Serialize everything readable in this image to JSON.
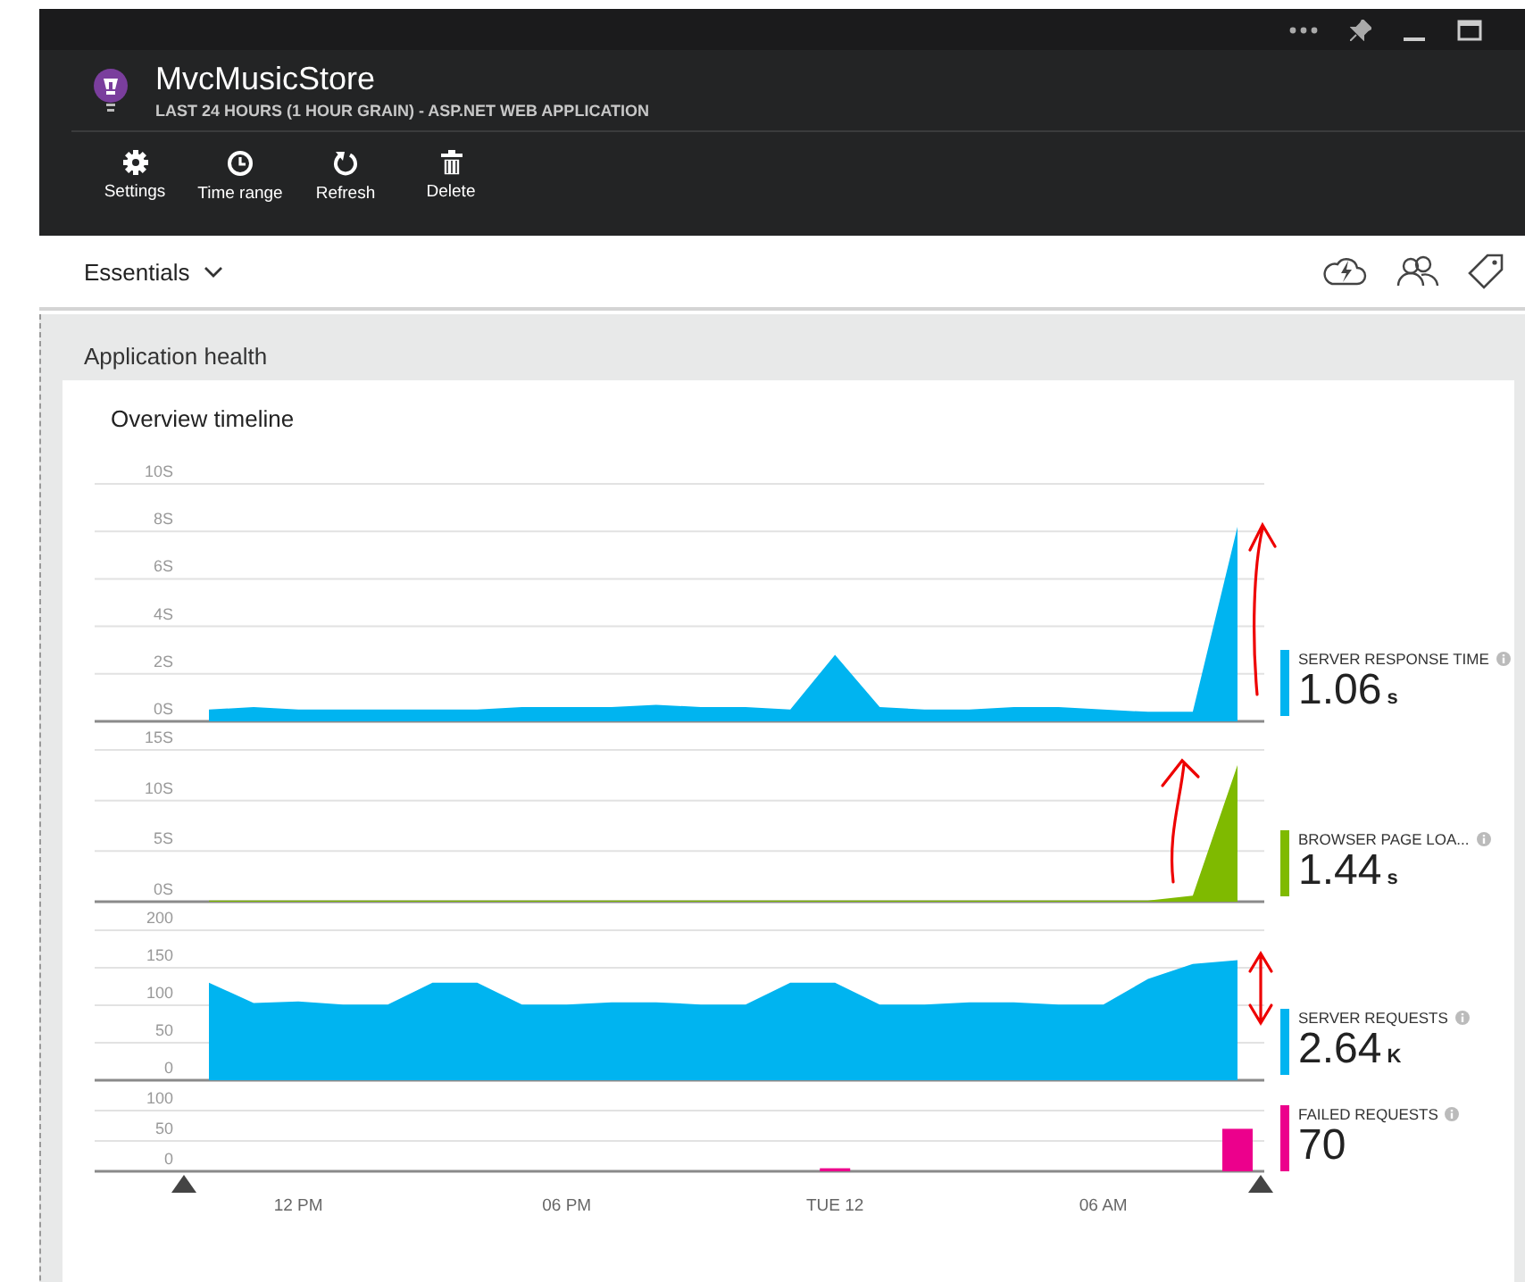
{
  "header": {
    "title": "MvcMusicStore",
    "subtitle": "LAST 24 HOURS (1 HOUR GRAIN) - ASP.NET WEB APPLICATION"
  },
  "toolbar": [
    {
      "kind": "settings",
      "label": "Settings"
    },
    {
      "kind": "time",
      "label": "Time range"
    },
    {
      "kind": "refresh",
      "label": "Refresh"
    },
    {
      "kind": "delete",
      "label": "Delete"
    }
  ],
  "essentials": {
    "label": "Essentials",
    "expanded": false
  },
  "section": {
    "title": "Application health"
  },
  "card": {
    "title": "Overview timeline"
  },
  "charts": [
    {
      "metric": {
        "label": "SERVER RESPONSE TIME",
        "value": "1.06",
        "unit": "s"
      },
      "chart_data": {
        "type": "area",
        "grid": true,
        "ylim": [
          0,
          10
        ],
        "yticks": [
          {
            "value": 0,
            "label": "0S"
          },
          {
            "value": 2,
            "label": "2S"
          },
          {
            "value": 4,
            "label": "4S"
          },
          {
            "value": 6,
            "label": "6S"
          },
          {
            "value": 8,
            "label": "8S"
          },
          {
            "value": 10,
            "label": "10S"
          }
        ],
        "series": [
          {
            "color": "#00b4f0",
            "values": [
              0.5,
              0.6,
              0.5,
              0.5,
              0.5,
              0.5,
              0.5,
              0.6,
              0.6,
              0.6,
              0.7,
              0.6,
              0.6,
              0.5,
              2.8,
              0.6,
              0.5,
              0.5,
              0.6,
              0.6,
              0.5,
              0.4,
              0.4,
              8.2
            ]
          }
        ]
      }
    },
    {
      "metric": {
        "label": "BROWSER PAGE LOA...",
        "value": "1.44",
        "unit": "s"
      },
      "chart_data": {
        "type": "area",
        "grid": true,
        "ylim": [
          0,
          15
        ],
        "yticks": [
          {
            "value": 0,
            "label": "0S"
          },
          {
            "value": 5,
            "label": "5S"
          },
          {
            "value": 10,
            "label": "10S"
          },
          {
            "value": 15,
            "label": "15S"
          }
        ],
        "series": [
          {
            "color": "#7fba00",
            "values": [
              0.1,
              0.1,
              0.1,
              0.1,
              0.1,
              0.1,
              0.1,
              0.1,
              0.1,
              0.1,
              0.1,
              0.1,
              0.1,
              0.1,
              0.1,
              0.1,
              0.1,
              0.1,
              0.1,
              0.1,
              0.1,
              0.1,
              0.6,
              13.5
            ]
          }
        ]
      }
    },
    {
      "metric": {
        "label": "SERVER REQUESTS",
        "value": "2.64",
        "unit": "K"
      },
      "chart_data": {
        "type": "area",
        "grid": true,
        "ylim": [
          0,
          200
        ],
        "yticks": [
          0,
          50,
          100,
          150,
          200
        ],
        "series": [
          {
            "color": "#00b4f0",
            "values": [
              130,
              103,
              105,
              101,
              101,
              130,
              130,
              101,
              101,
              104,
              104,
              101,
              101,
              130,
              130,
              101,
              101,
              104,
              104,
              101,
              101,
              135,
              155,
              160
            ]
          }
        ]
      }
    },
    {
      "metric": {
        "label": "FAILED REQUESTS",
        "value": "70"
      },
      "chart_data": {
        "type": "bar",
        "grid": true,
        "categories": [
          null,
          null,
          "12 PM",
          null,
          null,
          null,
          null,
          null,
          "06 PM",
          null,
          null,
          null,
          null,
          null,
          "TUE 12",
          null,
          null,
          null,
          null,
          null,
          "06 AM",
          null,
          null,
          null
        ],
        "ylim": [
          0,
          100
        ],
        "yticks": [
          0,
          50,
          100
        ],
        "series": [
          {
            "color": "#ec008c",
            "values": [
              0,
              0,
              0,
              0,
              0,
              0,
              0,
              0,
              0,
              0,
              0,
              0,
              0,
              0,
              5,
              0,
              0,
              0,
              0,
              0,
              0,
              0,
              0,
              70
            ]
          }
        ]
      }
    }
  ]
}
